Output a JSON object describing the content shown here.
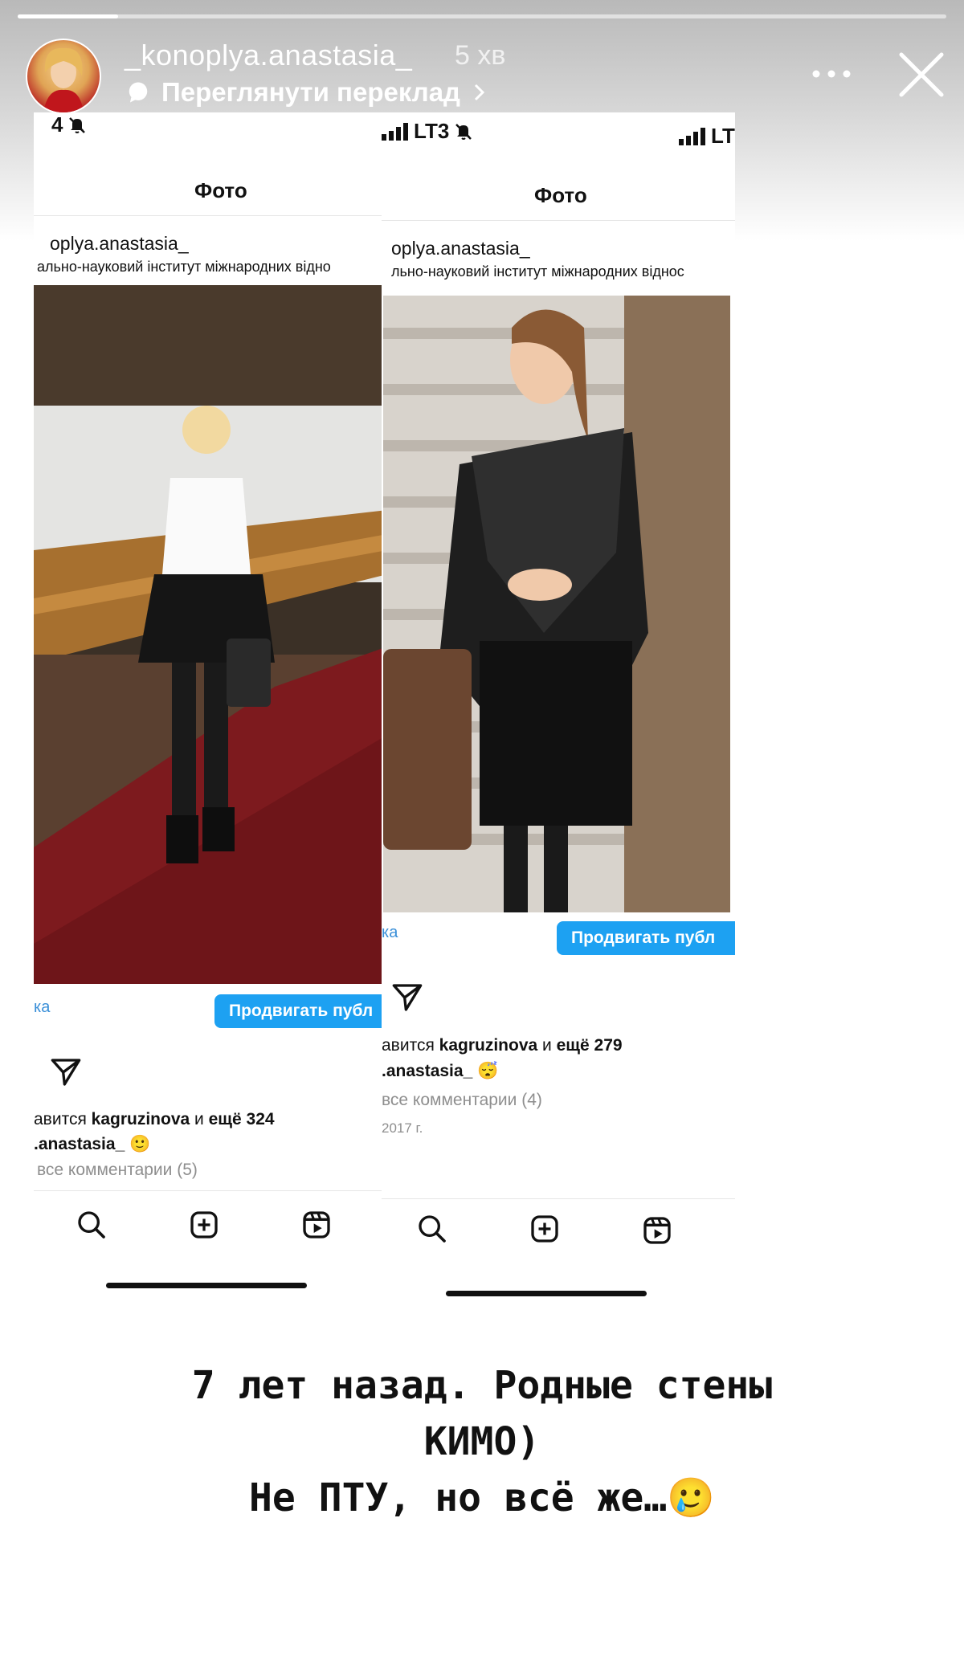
{
  "story": {
    "username": "_konoplya.anastasia_",
    "time_ago": "5 хв",
    "translate_label": "Переглянути переклад",
    "more_icon": "more-dots-icon",
    "close_icon": "close-icon"
  },
  "left_screenshot": {
    "status_left": "4",
    "status_network": "LT3",
    "header": "Фото",
    "username": "oplya.anastasia_",
    "location": "ально-науковий інститут міжнародних відно",
    "link_fragment": "ка",
    "promote_label": "Продвигать публ",
    "likes_prefix": "авится ",
    "likes_user": "kagruzinova",
    "likes_mid": " и ",
    "likes_count": "ещё 324",
    "caption_user": ".anastasia_",
    "comments": "все комментарии (5)"
  },
  "right_screenshot": {
    "status_network": "LT",
    "header": "Фото",
    "username": "oplya.anastasia_",
    "location": "льно-науковий інститут міжнародних віднос",
    "link_fragment": "ка",
    "promote_label": "Продвигать публ",
    "likes_prefix": "авится ",
    "likes_user": "kagruzinova",
    "likes_mid": " и ",
    "likes_count": "ещё 279",
    "caption_user": ".anastasia_",
    "comments": "все комментарии (4)",
    "date": "2017 г."
  },
  "story_text": {
    "line1": "7 лет назад. Родные стены",
    "line2": "КИМО)",
    "line3": "Не ПТУ, но всё же…"
  },
  "colors": {
    "accent_blue": "#1da1f2",
    "carpet_red": "#7d1a1e",
    "bg": "#ffffff"
  }
}
